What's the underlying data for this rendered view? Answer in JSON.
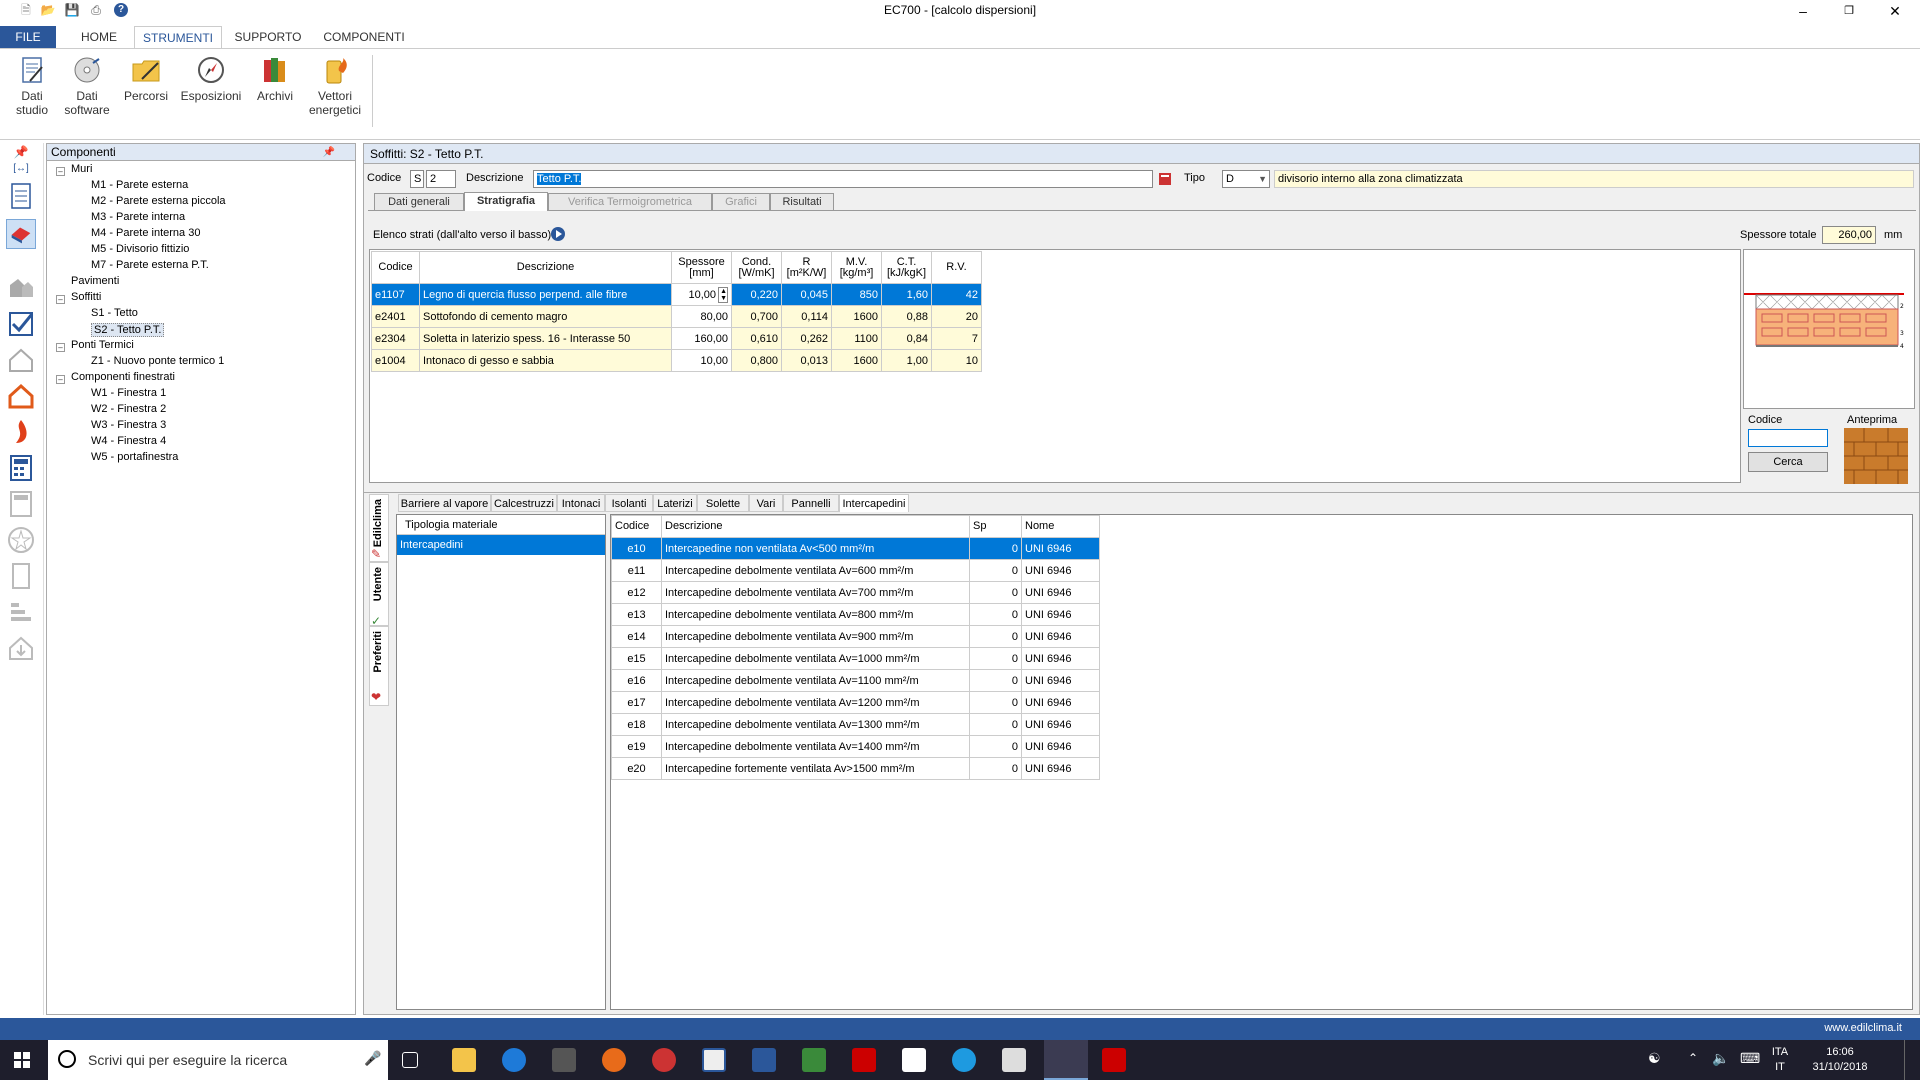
{
  "window": {
    "title": "EC700 - [calcolo dispersioni]"
  },
  "ribbon": {
    "tabs": [
      {
        "label": "FILE"
      },
      {
        "label": "HOME"
      },
      {
        "label": "STRUMENTI"
      },
      {
        "label": "SUPPORTO"
      },
      {
        "label": "COMPONENTI"
      }
    ],
    "buttons": [
      {
        "label": "Dati studio",
        "icon": "document-edit-icon"
      },
      {
        "label": "Dati software",
        "icon": "cd-icon"
      },
      {
        "label": "Percorsi",
        "icon": "folder-pencil-icon"
      },
      {
        "label": "Esposizioni",
        "icon": "compass-icon"
      },
      {
        "label": "Archivi",
        "icon": "books-icon"
      },
      {
        "label": "Vettori energetici",
        "icon": "fuel-icon"
      }
    ]
  },
  "tree": {
    "header": "Componenti",
    "nodes": [
      {
        "label": "Muri",
        "level": 0
      },
      {
        "label": "M1 - Parete esterna",
        "level": 1
      },
      {
        "label": "M2 - Parete esterna piccola",
        "level": 1
      },
      {
        "label": "M3 - Parete interna",
        "level": 1
      },
      {
        "label": "M4 - Parete interna 30",
        "level": 1
      },
      {
        "label": "M5 - Divisorio fittizio",
        "level": 1
      },
      {
        "label": "M7 - Parete esterna P.T.",
        "level": 1
      },
      {
        "label": "Pavimenti",
        "level": 0
      },
      {
        "label": "Soffitti",
        "level": 0
      },
      {
        "label": "S1 - Tetto",
        "level": 1
      },
      {
        "label": "S2 - Tetto P.T.",
        "level": 1
      },
      {
        "label": "Ponti Termici",
        "level": 0
      },
      {
        "label": "Z1 - Nuovo ponte termico 1",
        "level": 1
      },
      {
        "label": "Componenti finestrati",
        "level": 0
      },
      {
        "label": "W1 - Finestra 1",
        "level": 1
      },
      {
        "label": "W2 - Finestra 2",
        "level": 1
      },
      {
        "label": "W3 - Finestra 3",
        "level": 1
      },
      {
        "label": "W4 - Finestra 4",
        "level": 1
      },
      {
        "label": "W5 - portafinestra",
        "level": 1
      }
    ]
  },
  "main": {
    "header": "Soffitti: S2 - Tetto P.T.",
    "codice_label": "Codice",
    "codice_prefix": "S",
    "codice_value": "2",
    "descrizione_label": "Descrizione",
    "descrizione_value": "Tetto P.T.",
    "tipo_label": "Tipo",
    "tipo_value": "D",
    "tipo_desc": "divisorio interno alla zona climatizzata",
    "tabs": [
      {
        "label": "Dati generali"
      },
      {
        "label": "Stratigrafia"
      },
      {
        "label": "Verifica Termoigrometrica"
      },
      {
        "label": "Grafici"
      },
      {
        "label": "Risultati"
      }
    ],
    "elenco_label": "Elenco strati (dall'alto verso il basso)",
    "spessore_totale_label": "Spessore totale",
    "spessore_totale_value": "260,00",
    "spessore_unit": "mm",
    "layers_headers": [
      "Codice",
      "Descrizione",
      "Spessore\n[mm]",
      "Cond.\n[W/mK]",
      "R\n[m²K/W]",
      "M.V.\n[kg/m³]",
      "C.T.\n[kJ/kgK]",
      "R.V."
    ],
    "layers": [
      {
        "codice": "e1107",
        "descrizione": "Legno di quercia flusso perpend. alle fibre",
        "spessore": "10,00",
        "cond": "0,220",
        "r": "0,045",
        "mv": "850",
        "ct": "1,60",
        "rv": "42"
      },
      {
        "codice": "e2401",
        "descrizione": "Sottofondo di cemento magro",
        "spessore": "80,00",
        "cond": "0,700",
        "r": "0,114",
        "mv": "1600",
        "ct": "0,88",
        "rv": "20"
      },
      {
        "codice": "e2304",
        "descrizione": "Soletta in laterizio spess. 16 - Interasse 50",
        "spessore": "160,00",
        "cond": "0,610",
        "r": "0,262",
        "mv": "1100",
        "ct": "0,84",
        "rv": "7"
      },
      {
        "codice": "e1004",
        "descrizione": "Intonaco di gesso e sabbia",
        "spessore": "10,00",
        "cond": "0,800",
        "r": "0,013",
        "mv": "1600",
        "ct": "1,00",
        "rv": "10"
      }
    ],
    "cerca_codice_label": "Codice",
    "anteprima_label": "Anteprima",
    "cerca_button": "Cerca"
  },
  "library": {
    "side_tabs": [
      {
        "label": "Edilclima"
      },
      {
        "label": "Utente"
      },
      {
        "label": "Preferiti"
      }
    ],
    "tabs": [
      {
        "label": "Barriere al vapore"
      },
      {
        "label": "Calcestruzzi"
      },
      {
        "label": "Intonaci"
      },
      {
        "label": "Isolanti"
      },
      {
        "label": "Laterizi"
      },
      {
        "label": "Solette"
      },
      {
        "label": "Vari"
      },
      {
        "label": "Pannelli"
      },
      {
        "label": "Intercapedini"
      }
    ],
    "tipologia_header": "Tipologia materiale",
    "tipologia_items": [
      "Intercapedini"
    ],
    "materials_headers": [
      "Codice",
      "Descrizione",
      "Sp",
      "Nome"
    ],
    "materials": [
      {
        "codice": "e10",
        "descrizione": "Intercapedine non ventilata Av<500 mm²/m",
        "sp": "0",
        "nome": "UNI 6946"
      },
      {
        "codice": "e11",
        "descrizione": "Intercapedine debolmente ventilata Av=600 mm²/m",
        "sp": "0",
        "nome": "UNI 6946"
      },
      {
        "codice": "e12",
        "descrizione": "Intercapedine debolmente ventilata Av=700 mm²/m",
        "sp": "0",
        "nome": "UNI 6946"
      },
      {
        "codice": "e13",
        "descrizione": "Intercapedine debolmente ventilata Av=800 mm²/m",
        "sp": "0",
        "nome": "UNI 6946"
      },
      {
        "codice": "e14",
        "descrizione": "Intercapedine debolmente ventilata Av=900 mm²/m",
        "sp": "0",
        "nome": "UNI 6946"
      },
      {
        "codice": "e15",
        "descrizione": "Intercapedine debolmente ventilata Av=1000 mm²/m",
        "sp": "0",
        "nome": "UNI 6946"
      },
      {
        "codice": "e16",
        "descrizione": "Intercapedine debolmente ventilata Av=1100 mm²/m",
        "sp": "0",
        "nome": "UNI 6946"
      },
      {
        "codice": "e17",
        "descrizione": "Intercapedine debolmente ventilata Av=1200 mm²/m",
        "sp": "0",
        "nome": "UNI 6946"
      },
      {
        "codice": "e18",
        "descrizione": "Intercapedine debolmente ventilata Av=1300 mm²/m",
        "sp": "0",
        "nome": "UNI 6946"
      },
      {
        "codice": "e19",
        "descrizione": "Intercapedine debolmente ventilata Av=1400 mm²/m",
        "sp": "0",
        "nome": "UNI 6946"
      },
      {
        "codice": "e20",
        "descrizione": "Intercapedine fortemente ventilata Av>1500 mm²/m",
        "sp": "0",
        "nome": "UNI 6946"
      }
    ]
  },
  "status": {
    "website": "www.edilclima.it"
  },
  "taskbar": {
    "search_placeholder": "Scrivi qui per eseguire la ricerca",
    "lang1": "ITA",
    "lang2": "IT",
    "time": "16:06",
    "date": "31/10/2018"
  },
  "colors": {
    "accent": "#2b579a",
    "selection": "#0078d7",
    "row_highlight": "#fffbd9"
  }
}
